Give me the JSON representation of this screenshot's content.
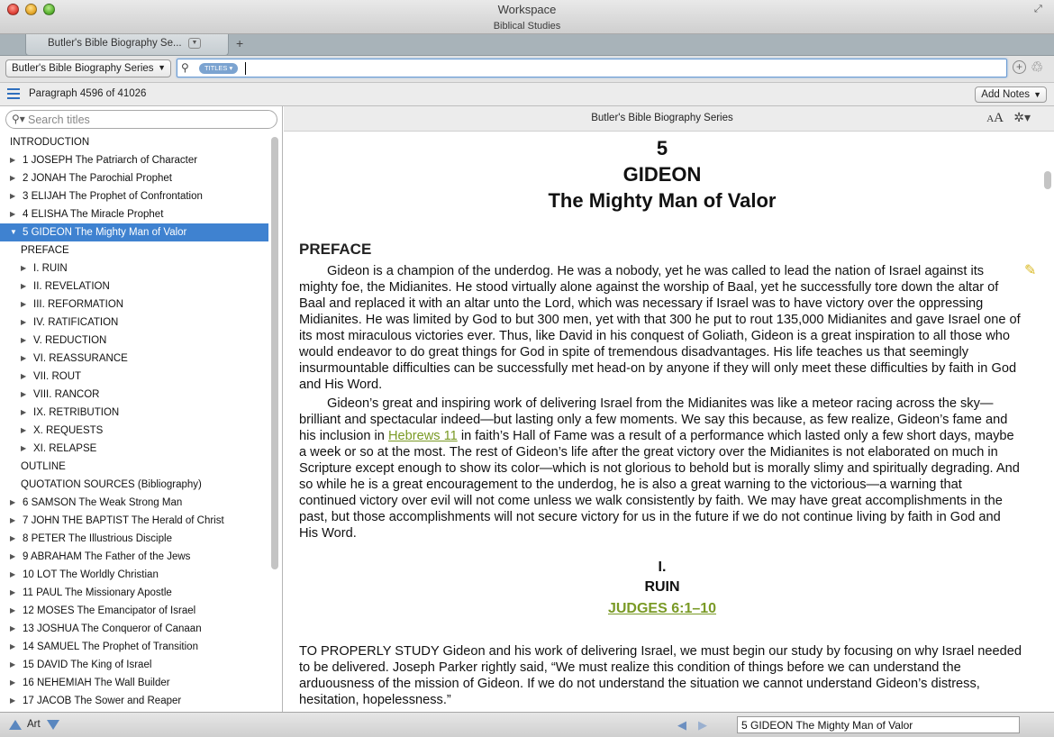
{
  "window": {
    "title": "Workspace",
    "subtitle": "Biblical Studies"
  },
  "tabs": [
    {
      "label": "Butler's Bible Biography Se..."
    }
  ],
  "toolbar": {
    "library_select": "Butler's Bible Biography Series",
    "search_scope": "TITLES",
    "search_value": ""
  },
  "status": {
    "paragraph": "Paragraph 4596 of 41026",
    "add_notes": "Add Notes"
  },
  "sidebar": {
    "search_placeholder": "Search titles",
    "items": [
      {
        "label": "INTRODUCTION",
        "level": 0,
        "expander": "none"
      },
      {
        "label": "1 JOSEPH The Patriarch of Character",
        "level": 0,
        "expander": "collapsed"
      },
      {
        "label": "2 JONAH The Parochial Prophet",
        "level": 0,
        "expander": "collapsed"
      },
      {
        "label": "3 ELIJAH The Prophet of Confrontation",
        "level": 0,
        "expander": "collapsed"
      },
      {
        "label": "4 ELISHA The Miracle Prophet",
        "level": 0,
        "expander": "collapsed"
      },
      {
        "label": "5 GIDEON The Mighty Man of Valor",
        "level": 0,
        "expander": "expanded",
        "selected": true
      },
      {
        "label": "PREFACE",
        "level": 1,
        "expander": "none"
      },
      {
        "label": "I. RUIN",
        "level": 1,
        "expander": "collapsed"
      },
      {
        "label": "II. REVELATION",
        "level": 1,
        "expander": "collapsed"
      },
      {
        "label": "III. REFORMATION",
        "level": 1,
        "expander": "collapsed"
      },
      {
        "label": "IV. RATIFICATION",
        "level": 1,
        "expander": "collapsed"
      },
      {
        "label": "V. REDUCTION",
        "level": 1,
        "expander": "collapsed"
      },
      {
        "label": "VI. REASSURANCE",
        "level": 1,
        "expander": "collapsed"
      },
      {
        "label": "VII. ROUT",
        "level": 1,
        "expander": "collapsed"
      },
      {
        "label": "VIII. RANCOR",
        "level": 1,
        "expander": "collapsed"
      },
      {
        "label": "IX. RETRIBUTION",
        "level": 1,
        "expander": "collapsed"
      },
      {
        "label": "X. REQUESTS",
        "level": 1,
        "expander": "collapsed"
      },
      {
        "label": "XI. RELAPSE",
        "level": 1,
        "expander": "collapsed"
      },
      {
        "label": "OUTLINE",
        "level": 1,
        "expander": "none"
      },
      {
        "label": "QUOTATION SOURCES (Bibliography)",
        "level": 1,
        "expander": "none"
      },
      {
        "label": "6 SAMSON The Weak Strong Man",
        "level": 0,
        "expander": "collapsed"
      },
      {
        "label": "7 JOHN THE BAPTIST The Herald of Christ",
        "level": 0,
        "expander": "collapsed"
      },
      {
        "label": "8 PETER The Illustrious Disciple",
        "level": 0,
        "expander": "collapsed"
      },
      {
        "label": "9 ABRAHAM The Father of the Jews",
        "level": 0,
        "expander": "collapsed"
      },
      {
        "label": "10 LOT The Worldly Christian",
        "level": 0,
        "expander": "collapsed"
      },
      {
        "label": "11 PAUL The Missionary Apostle",
        "level": 0,
        "expander": "collapsed"
      },
      {
        "label": "12 MOSES The Emancipator of Israel",
        "level": 0,
        "expander": "collapsed"
      },
      {
        "label": "13 JOSHUA The Conqueror of Canaan",
        "level": 0,
        "expander": "collapsed"
      },
      {
        "label": "14 SAMUEL The Prophet of Transition",
        "level": 0,
        "expander": "collapsed"
      },
      {
        "label": "15 DAVID The King of Israel",
        "level": 0,
        "expander": "collapsed"
      },
      {
        "label": "16 NEHEMIAH The Wall Builder",
        "level": 0,
        "expander": "collapsed"
      },
      {
        "label": "17 JACOB The Sower and Reaper",
        "level": 0,
        "expander": "collapsed"
      }
    ]
  },
  "content": {
    "header_title": "Butler's Bible Biography Series",
    "chapter_number": "5",
    "chapter_title": "GIDEON",
    "chapter_subtitle": "The Mighty Man of Valor",
    "preface_heading": "PREFACE",
    "preface_p1": "Gideon is a champion of the underdog. He was a nobody, yet he was called to lead the nation of Israel against its mighty foe, the Midianites. He stood virtually alone against the worship of Baal, yet he successfully tore down the altar of Baal and replaced it with an altar unto the Lord, which was necessary if Israel was to have victory over the oppressing Midianites. He was limited by God to but 300 men, yet with that 300 he put to rout 135,000 Midianites and gave Israel one of its most miraculous victories ever. Thus, like David in his conquest of Goliath, Gideon is a great inspiration to all those who would endeavor to do great things for God in spite of tremendous disadvantages. His life teaches us that seemingly insurmountable difficulties can be successfully met head-on by anyone if they will only meet these difficulties by faith in God and His Word.",
    "preface_p2_a": "Gideon’s great and inspiring work of delivering Israel from the Midianites was like a meteor racing across the sky—brilliant and spectacular indeed—but lasting only a few moments. We say this because, as few realize, Gideon’s fame and his inclusion in",
    "preface_p2_link": "Hebrews 11",
    "preface_p2_b": "in faith’s Hall of Fame was a result of a performance which lasted only a few short days, maybe a week or so at the most. The rest of Gideon’s life after the great victory over the Midianites is not elaborated on much in Scripture except enough to show its color—which is not glorious to behold but is morally slimy and spiritually degrading. And so while he is a great encouragement to the underdog, he is also a great warning to the victorious—a warning that continued victory over evil will not come unless we walk consistently by faith. We may have great accomplishments in the past, but those accomplishments will not secure victory for us in the future if we do not continue living by faith in God and His Word.",
    "section_number": "I.",
    "section_title": "RUIN",
    "section_ref": "JUDGES 6:1–10",
    "section_p1": "TO PROPERLY STUDY Gideon and his work of delivering Israel, we must begin our study by focusing on why Israel needed to be delivered. Joseph Parker rightly said, “We must realize this condition of things before we can understand the arduousness of the mission of Gideon. If we do not understand the situation we cannot understand Gideon’s distress, hesitation, hopelessness.”"
  },
  "bottombar": {
    "art_label": "Art",
    "location": "5 GIDEON The Mighty Man of Valor"
  },
  "colors": {
    "selection": "#3f82d0",
    "link": "#7a9a26",
    "tabbar": "#a8b3b9"
  }
}
